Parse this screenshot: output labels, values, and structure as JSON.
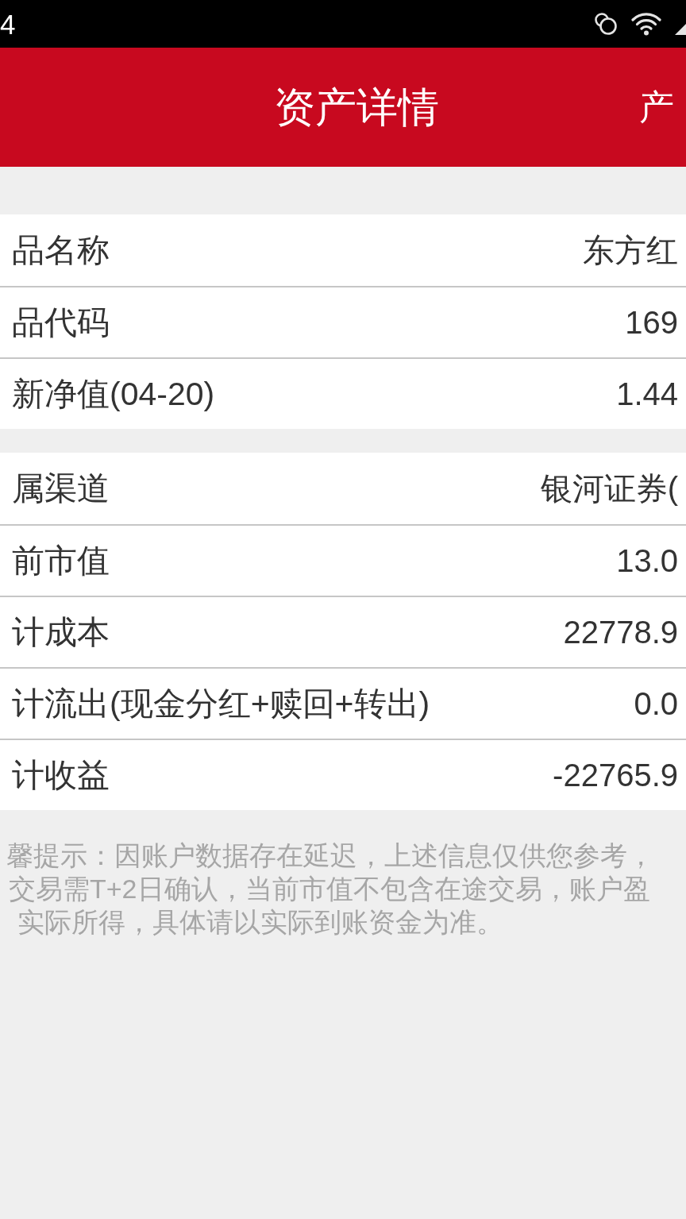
{
  "status_bar": {
    "time": "4"
  },
  "header": {
    "title": "资产详情",
    "action": "产"
  },
  "sections": [
    {
      "rows": [
        {
          "label": "品名称",
          "value": "东方红"
        },
        {
          "label": "品代码",
          "value": "169"
        },
        {
          "label": "新净值(04-20)",
          "value": "1.44"
        }
      ]
    },
    {
      "rows": [
        {
          "label": "属渠道",
          "value": "银河证券("
        },
        {
          "label": "前市值",
          "value": "13.0"
        },
        {
          "label": "计成本",
          "value": "22778.9"
        },
        {
          "label": "计流出(现金分红+赎回+转出)",
          "value": "0.0"
        },
        {
          "label": "计收益",
          "value": "-22765.9"
        }
      ]
    }
  ],
  "notice_lines": [
    "馨提示：因账户数据存在延迟，上述信息仅供您参考，",
    "交易需T+2日确认，当前市值不包含在途交易，账户盈",
    "实际所得，具体请以实际到账资金为准。"
  ]
}
